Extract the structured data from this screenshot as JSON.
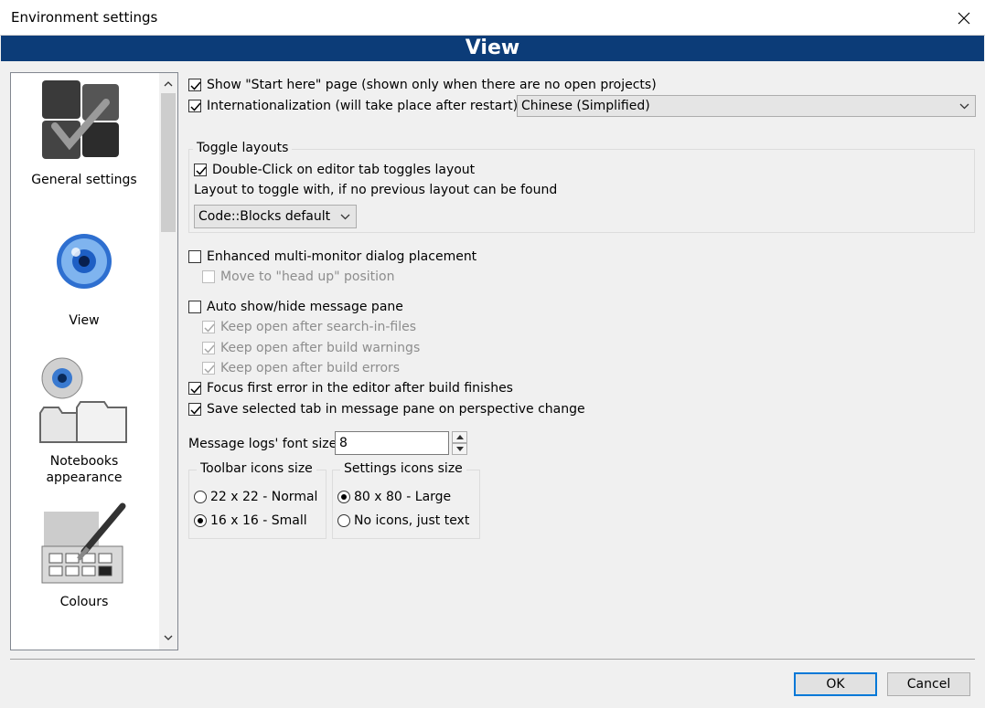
{
  "window": {
    "title": "Environment settings"
  },
  "header": {
    "title": "View"
  },
  "sidebar": {
    "items": [
      {
        "label": "General settings",
        "icon": "general-settings-icon"
      },
      {
        "label": "View",
        "icon": "eye-icon"
      },
      {
        "label": "Notebooks appearance",
        "icon": "notebooks-icon"
      },
      {
        "label": "Colours",
        "icon": "palette-icon"
      }
    ]
  },
  "options": {
    "show_start_here": {
      "label": "Show \"Start here\" page (shown only when there are no open projects)",
      "checked": true
    },
    "internationalization": {
      "label": "Internationalization (will take place after restart)",
      "checked": true
    },
    "language_select": {
      "value": "Chinese (Simplified)"
    },
    "toggle_layouts": {
      "legend": "Toggle layouts",
      "double_click": {
        "label": "Double-Click on editor tab toggles layout",
        "checked": true
      },
      "layout_text": "Layout to toggle with, if no previous layout can be found",
      "layout_select": {
        "value": "Code::Blocks default"
      }
    },
    "enhanced_multimonitor": {
      "label": "Enhanced multi-monitor dialog placement",
      "checked": false
    },
    "head_up": {
      "label": "Move to \"head up\" position",
      "checked": false,
      "disabled": true
    },
    "auto_show_hide": {
      "label": "Auto show/hide message pane",
      "checked": false
    },
    "keep_open_search": {
      "label": "Keep open after search-in-files",
      "checked": true,
      "disabled": true
    },
    "keep_open_warnings": {
      "label": "Keep open after build warnings",
      "checked": true,
      "disabled": true
    },
    "keep_open_errors": {
      "label": "Keep open after build errors",
      "checked": true,
      "disabled": true
    },
    "focus_first_error": {
      "label": "Focus first error in the editor after build finishes",
      "checked": true
    },
    "save_selected_tab": {
      "label": "Save selected tab in message pane on perspective change",
      "checked": true
    },
    "font_size": {
      "label": "Message logs' font size:",
      "value": "8"
    },
    "toolbar_icons": {
      "legend": "Toolbar icons size",
      "options": [
        {
          "label": "22 x 22 - Normal",
          "selected": false
        },
        {
          "label": "16 x 16 - Small",
          "selected": true
        }
      ]
    },
    "settings_icons": {
      "legend": "Settings icons size",
      "options": [
        {
          "label": "80 x 80 - Large",
          "selected": true
        },
        {
          "label": "No icons, just text",
          "selected": false
        }
      ]
    }
  },
  "buttons": {
    "ok": "OK",
    "cancel": "Cancel"
  }
}
